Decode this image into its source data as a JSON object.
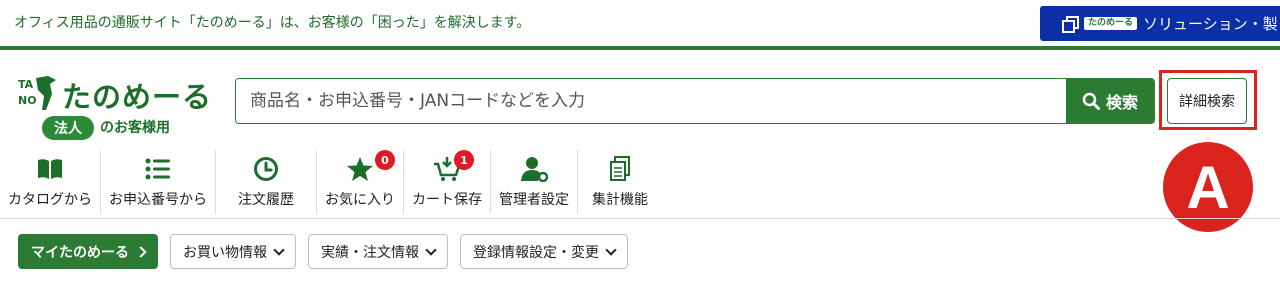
{
  "topbar": {
    "tagline": "オフィス用品の通販サイト「たのめーる」は、お客様の「困った」を解決します。",
    "solution_logo": "たのめーる",
    "solution_label": "ソリューション・製"
  },
  "header": {
    "brand": "たのめーる",
    "corp_badge": "法人",
    "corp_sub": "のお客様用",
    "search_placeholder": "商品名・お申込番号・JANコードなどを入力",
    "search_button": "検索",
    "advanced_search": "詳細検索",
    "marker": "A"
  },
  "nav": [
    {
      "label": "カタログから",
      "icon": "book-icon"
    },
    {
      "label": "お申込番号から",
      "icon": "list-icon"
    },
    {
      "label": "注文履歴",
      "icon": "clock-icon"
    },
    {
      "label": "お気に入り",
      "icon": "star-icon",
      "badge": "0"
    },
    {
      "label": "カート保存",
      "icon": "cart-download-icon",
      "badge": "1"
    },
    {
      "label": "管理者設定",
      "icon": "admin-user-icon"
    },
    {
      "label": "集計機能",
      "icon": "documents-icon"
    }
  ],
  "subnav": {
    "my_tanomail": "マイたのめーる",
    "shopping_info": "お買い物情報",
    "order_info": "実績・注文情報",
    "registration": "登録情報設定・変更"
  },
  "colors": {
    "brand_green": "#2b7b33",
    "solution_blue": "#0a2fa6",
    "highlight_red": "#d9231c",
    "badge_red": "#e01a22"
  }
}
